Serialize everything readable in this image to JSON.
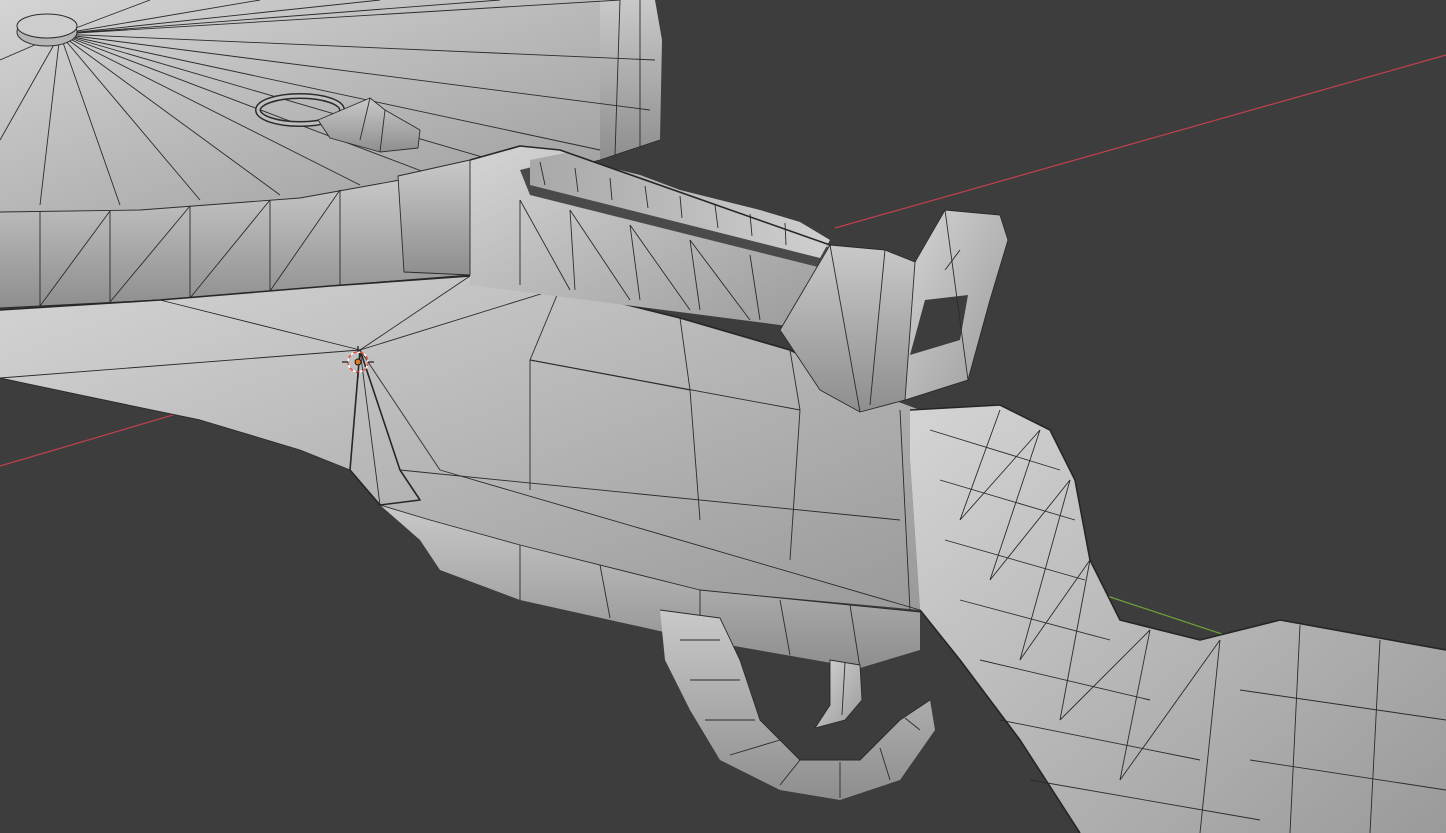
{
  "viewport": {
    "editor": "3D Viewport",
    "shading": "solid-wireframe",
    "background_color": "#3d3d3d",
    "mesh_color": "#b8b8b8",
    "wire_color": "#2b2b2b",
    "x_axis_color": "#c0414d",
    "y_axis_color": "#6fa33a",
    "cursor_color": "#e0533c"
  },
  "scene": {
    "objects": [
      "drum-magazine",
      "receiver",
      "top-rail",
      "rear-sight",
      "trigger-guard",
      "trigger",
      "stock",
      "sling-loop"
    ],
    "icons": [
      "3d-cursor-icon"
    ]
  }
}
